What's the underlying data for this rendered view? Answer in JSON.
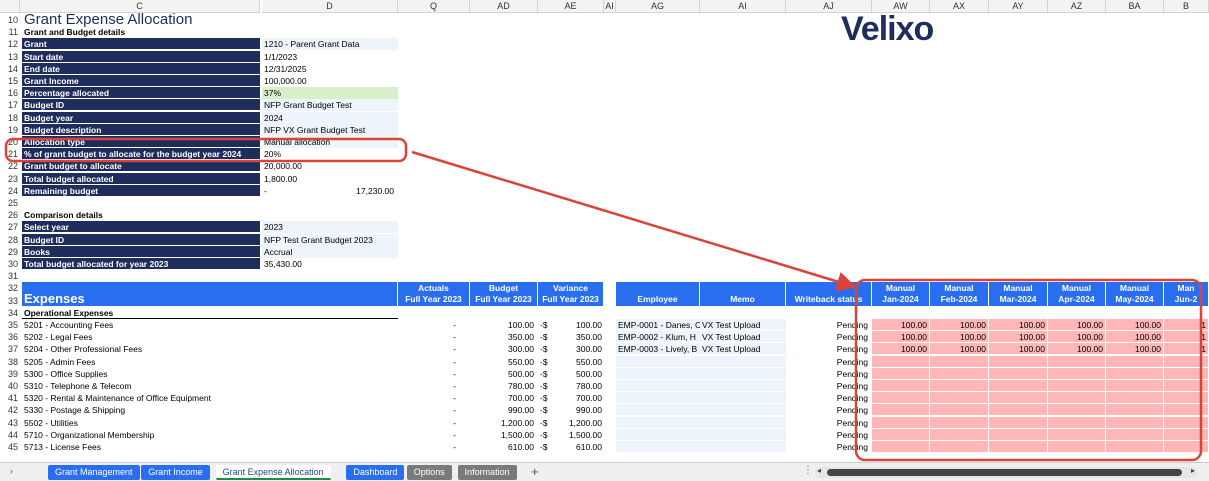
{
  "column_headers": [
    "C",
    "D",
    "Q",
    "AD",
    "AE",
    "AI",
    "AG",
    "AI",
    "AJ",
    "AW",
    "AX",
    "AY",
    "AZ",
    "BA",
    "B"
  ],
  "title": "Grant Expense Allocation",
  "section_grant": "Grant and Budget details",
  "grant_rows": [
    {
      "row": "12",
      "label": "Grant",
      "value": "1210 - Parent Grant Data"
    },
    {
      "row": "13",
      "label": "Start date",
      "value": "1/1/2023"
    },
    {
      "row": "14",
      "label": "End date",
      "value": "12/31/2025"
    },
    {
      "row": "15",
      "label": "Grant Income",
      "value": "100,000.00"
    },
    {
      "row": "16",
      "label": "Percentage allocated",
      "value": "37%"
    },
    {
      "row": "17",
      "label": "Budget ID",
      "value": "NFP Grant Budget Test"
    },
    {
      "row": "18",
      "label": "Budget year",
      "value": "2024"
    },
    {
      "row": "19",
      "label": "Budget description",
      "value": "NFP VX Grant Budget Test"
    },
    {
      "row": "20",
      "label": "Allocation type",
      "value": "Manual allocation"
    },
    {
      "row": "21",
      "label": "% of grant budget to allocate for the budget year 2024",
      "value": "20%"
    },
    {
      "row": "22",
      "label": "Grant budget to allocate",
      "value": "20,000.00"
    },
    {
      "row": "23",
      "label": "Total budget allocated",
      "value": "1,800.00"
    },
    {
      "row": "24",
      "label": "Remaining budget",
      "value": "-",
      "value2": "17,230.00"
    }
  ],
  "section_comparison": "Comparison details",
  "comparison_rows": [
    {
      "row": "27",
      "label": "Select year",
      "value": "2023"
    },
    {
      "row": "28",
      "label": "Budget ID",
      "value": "NFP Test Grant Budget 2023"
    },
    {
      "row": "29",
      "label": "Books",
      "value": "Accrual"
    },
    {
      "row": "30",
      "label": "Total budget allocated for year 2023",
      "value": "35,430.00"
    }
  ],
  "expenses_header": "Expenses",
  "table_headers": {
    "actuals": [
      "Actuals",
      "Full Year 2023"
    ],
    "budget": [
      "Budget",
      "Full Year 2023"
    ],
    "variance": [
      "Variance",
      "Full Year 2023"
    ],
    "employee": "Employee",
    "memo": "Memo",
    "writeback": "Writeback status",
    "months": [
      [
        "Manual",
        "Jan-2024"
      ],
      [
        "Manual",
        "Feb-2024"
      ],
      [
        "Manual",
        "Mar-2024"
      ],
      [
        "Manual",
        "Apr-2024"
      ],
      [
        "Manual",
        "May-2024"
      ],
      [
        "Man",
        "Jun-2"
      ]
    ]
  },
  "operational_label": "Operational Expenses",
  "expense_rows": [
    {
      "row": "35",
      "name": "5201 - Accounting Fees",
      "actual": "-",
      "budget": "100.00",
      "variance": "100.00",
      "employee": "EMP-0001 - Danes, C",
      "memo": "VX Test Upload",
      "status": "Pending",
      "months": [
        "100.00",
        "100.00",
        "100.00",
        "100.00",
        "100.00",
        "1"
      ]
    },
    {
      "row": "36",
      "name": "5202 - Legal Fees",
      "actual": "-",
      "budget": "350.00",
      "variance": "350.00",
      "employee": "EMP-0002 - Klum, H",
      "memo": "VX Test Upload",
      "status": "Pending",
      "months": [
        "100.00",
        "100.00",
        "100.00",
        "100.00",
        "100.00",
        "1"
      ]
    },
    {
      "row": "37",
      "name": "5204 - Other Professional Fees",
      "actual": "-",
      "budget": "300.00",
      "variance": "300.00",
      "employee": "EMP-0003 - Lively, B",
      "memo": "VX Test Upload",
      "status": "Pending",
      "months": [
        "100.00",
        "100.00",
        "100.00",
        "100.00",
        "100.00",
        "1"
      ]
    },
    {
      "row": "38",
      "name": "5205 - Admin Fees",
      "actual": "-",
      "budget": "550.00",
      "variance": "550.00",
      "employee": "",
      "memo": "",
      "status": "Pending",
      "months": [
        "",
        "",
        "",
        "",
        "",
        ""
      ]
    },
    {
      "row": "39",
      "name": "5300 - Office Supplies",
      "actual": "-",
      "budget": "500.00",
      "variance": "500.00",
      "employee": "",
      "memo": "",
      "status": "Pending",
      "months": [
        "",
        "",
        "",
        "",
        "",
        ""
      ]
    },
    {
      "row": "40",
      "name": "5310 - Telephone & Telecom",
      "actual": "-",
      "budget": "780.00",
      "variance": "780.00",
      "employee": "",
      "memo": "",
      "status": "Pending",
      "months": [
        "",
        "",
        "",
        "",
        "",
        ""
      ]
    },
    {
      "row": "41",
      "name": "5320 - Rental & Maintenance of Office Equipment",
      "actual": "-",
      "budget": "700.00",
      "variance": "700.00",
      "employee": "",
      "memo": "",
      "status": "Pending",
      "months": [
        "",
        "",
        "",
        "",
        "",
        ""
      ]
    },
    {
      "row": "42",
      "name": "5330 - Postage & Shipping",
      "actual": "-",
      "budget": "990.00",
      "variance": "990.00",
      "employee": "",
      "memo": "",
      "status": "Pending",
      "months": [
        "",
        "",
        "",
        "",
        "",
        ""
      ]
    },
    {
      "row": "43",
      "name": "5502 - Utilities",
      "actual": "-",
      "budget": "1,200.00",
      "variance": "1,200.00",
      "employee": "",
      "memo": "",
      "status": "Pending",
      "months": [
        "",
        "",
        "",
        "",
        "",
        ""
      ]
    },
    {
      "row": "44",
      "name": "5710 - Organizational Membership",
      "actual": "-",
      "budget": "1,500.00",
      "variance": "1,500.00",
      "employee": "",
      "memo": "",
      "status": "Pending",
      "months": [
        "",
        "",
        "",
        "",
        "",
        ""
      ]
    },
    {
      "row": "45",
      "name": "5713 - License Fees",
      "actual": "-",
      "budget": "610.00",
      "variance": "610.00",
      "employee": "",
      "memo": "",
      "status": "Pending",
      "months": [
        "",
        "",
        "",
        "",
        "",
        ""
      ]
    }
  ],
  "variance_prefix": "-$",
  "logo_text": "Velixo",
  "tabs": [
    {
      "label": "Grant Management",
      "style": "blue"
    },
    {
      "label": "Grant Income",
      "style": "blue"
    },
    {
      "label": "Grant Expense Allocation",
      "style": "active"
    },
    {
      "label": "Dashboard",
      "style": "blue"
    },
    {
      "label": "Options",
      "style": "gray"
    },
    {
      "label": "Information",
      "style": "gray"
    }
  ],
  "add_sheet": "+",
  "colors": {
    "navy": "#1f2d5c",
    "blue": "#2a6ef0",
    "pink": "#ffb6b6",
    "annotation": "#d9443a"
  }
}
